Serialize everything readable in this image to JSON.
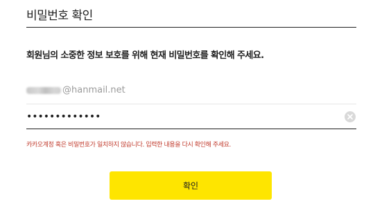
{
  "header": {
    "title": "비밀번호 확인"
  },
  "main": {
    "instruction": "회원님의 소중한 정보 보호를 위해 현재 비밀번호를 확인해 주세요.",
    "email_field": {
      "value_domain": "@hanmail.net"
    },
    "password_field": {
      "masked_value": "•••••••••••••"
    },
    "error_message": "카카오계정 혹은 비밀번호가 일치하지 않습니다. 입력한 내용을 다시 확인해 주세요.",
    "confirm_label": "확인"
  },
  "icons": {
    "clear": "clear-circle-x-icon"
  },
  "colors": {
    "accent_button": "#fee500",
    "error_text": "#c0392b",
    "text_primary": "#1e1e1e",
    "placeholder_gray": "#9a9a9a"
  }
}
